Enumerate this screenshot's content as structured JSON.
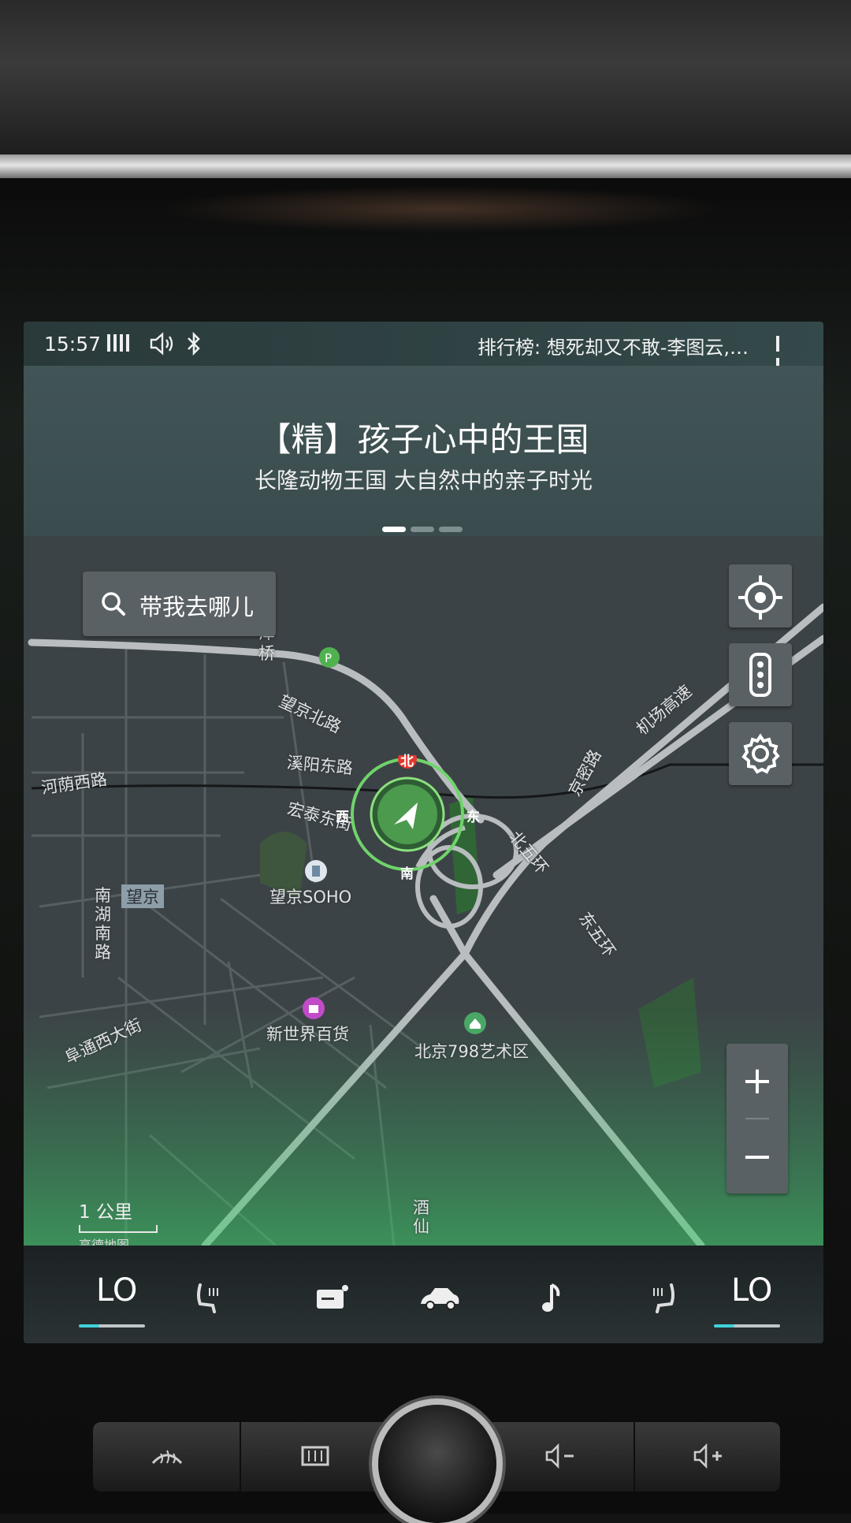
{
  "status_bar": {
    "time": "15:57",
    "music_ticker": "排行榜: 想死却又不敢-李图云,…",
    "icons": [
      "signal-icon",
      "volume-icon",
      "bluetooth-icon",
      "pause-icon"
    ]
  },
  "banner": {
    "title": "【精】孩子心中的王国",
    "subtitle": "长隆动物王国 大自然中的亲子时光",
    "page_count": 3,
    "active_page": 1
  },
  "map": {
    "search_placeholder": "带我去哪儿",
    "compass": {
      "north": "北",
      "south": "南",
      "west": "西",
      "east": "东"
    },
    "scale_label": "1 公里",
    "provider": "高德地图",
    "zoom_in": "+",
    "zoom_out": "−",
    "labels": {
      "zeqiao": "泽\n桥",
      "wangjing_north": "望京北路",
      "xiyang_east": "溪阳东路",
      "hongtai_east": "宏泰东街",
      "heyin_west": "河荫西路",
      "jingmi": "京密路",
      "airport_expressway": "机场高速",
      "north_5th_ring": "北五环",
      "east_5th_ring": "东五环",
      "wangjing_district": "望京",
      "nanhu_south": "南\n湖\n南\n路",
      "wangjing_soho": "望京SOHO",
      "futong_west": "阜通西大街",
      "new_world": "新世界百货",
      "art_798": "北京798艺术区",
      "jiuxian": "酒\n仙"
    },
    "accent_color": "#6fd46b"
  },
  "climate": {
    "left_temp": "LO",
    "right_temp": "LO"
  },
  "colors": {
    "route_green": "#4caf50",
    "teal_indicator": "#3fd1d9"
  }
}
